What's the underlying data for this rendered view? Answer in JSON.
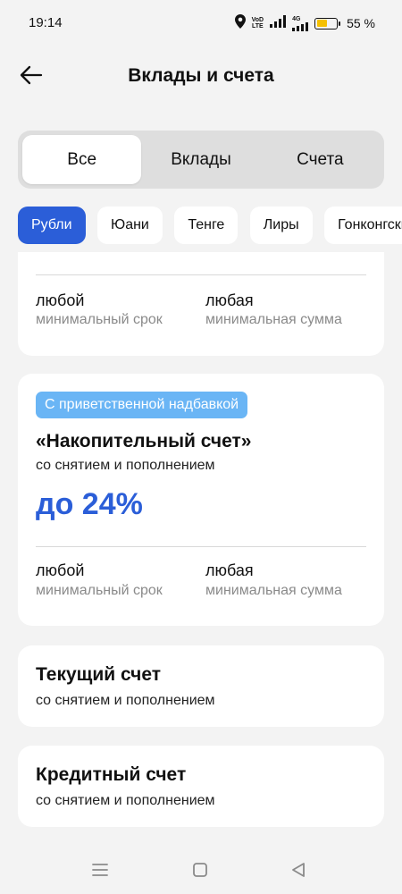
{
  "status_bar": {
    "time": "19:14",
    "network_label_1": "VoD",
    "network_label_2": "LTE",
    "network_gen": "4G",
    "battery_text": "55 %",
    "battery_level": 0.55,
    "battery_color": "#f5c000"
  },
  "header": {
    "title": "Вклады и счета",
    "back_icon": "arrow-left-icon"
  },
  "segmented": {
    "items": [
      "Все",
      "Вклады",
      "Счета"
    ],
    "selected": "Все"
  },
  "currencies": {
    "items": [
      "Рубли",
      "Юани",
      "Тенге",
      "Лиры",
      "Гонконгские"
    ],
    "selected": "Рубли"
  },
  "cards": [
    {
      "term_value": "любой",
      "term_label": "минимальный срок",
      "amount_value": "любая",
      "amount_label": "минимальная сумма"
    },
    {
      "badge": "С приветственной надбавкой",
      "title": "«Накопительный счет»",
      "subtitle": "со снятием и пополнением",
      "rate": "до 24%",
      "term_value": "любой",
      "term_label": "минимальный срок",
      "amount_value": "любая",
      "amount_label": "минимальная сумма"
    },
    {
      "title": "Текущий счет",
      "subtitle": "со снятием и пополнением"
    },
    {
      "title": "Кредитный счет",
      "subtitle": "со снятием и пополнением"
    }
  ],
  "colors": {
    "accent": "#2b5ed8",
    "badge": "#6ab5f5",
    "background": "#f3f3f3"
  },
  "nav_bar": {
    "icons": [
      "menu-icon",
      "home-square-icon",
      "back-triangle-icon"
    ]
  }
}
